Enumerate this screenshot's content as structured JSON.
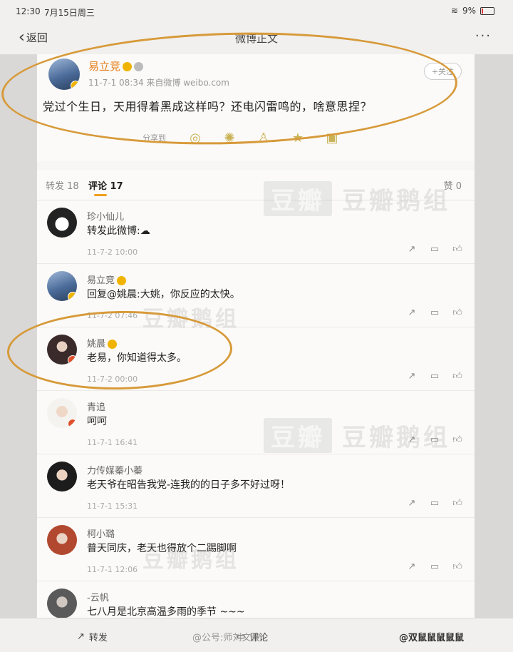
{
  "status_bar": {
    "time": "12:30",
    "date": "7月15日周三",
    "battery": "9%"
  },
  "nav": {
    "back_label": "返回",
    "title": "微博正文",
    "more": "···"
  },
  "post": {
    "author": "易立竞",
    "time_source": "11-7-1 08:34  来自微博 weibo.com",
    "follow_label": "+关注",
    "text": "党过个生日，天用得着黑成这样吗？还电闪雷鸣的，啥意思捏？",
    "share_label": "分享到"
  },
  "tabs": {
    "forward": "转发 18",
    "comment": "评论 17",
    "like": "赞 0"
  },
  "comments": [
    {
      "name": "珍小仙儿",
      "text": "转发此微博:☁",
      "time": "11-7-2 10:00"
    },
    {
      "name": "易立竞",
      "text": "回复@姚晨:大姚，你反应的太快。",
      "time": "11-7-2 07:46"
    },
    {
      "name": "姚晨",
      "text": "老易，你知道得太多。",
      "time": "11-7-2 00:00"
    },
    {
      "name": "青追",
      "text": "呵呵",
      "time": "11-7-1 16:41"
    },
    {
      "name": "力传媒蓁小蓁",
      "text": "老天爷在昭告我党-连我的的日子多不好过呀！",
      "time": "11-7-1 15:31"
    },
    {
      "name": "柯小璐",
      "text": "普天同庆，老天也得放个二踢脚啊",
      "time": "11-7-1 12:06"
    },
    {
      "name": "-云帆",
      "text": "七八月是北京高温多雨的季节 ~~~",
      "time": ""
    }
  ],
  "watermarks": {
    "brand_box": "豆瓣",
    "brand_text": "豆瓣鹅组",
    "brand_short": "豆瓣鹅组"
  },
  "bottom_bar": {
    "forward": "转发",
    "comment": "评论"
  },
  "credits": {
    "left": "@公号:师刘文波",
    "right": "@双鼠鼠鼠鼠鼠"
  },
  "colors": {
    "highlight": "#d79a3a",
    "username": "#e57e1a",
    "accent": "#f0a020"
  }
}
